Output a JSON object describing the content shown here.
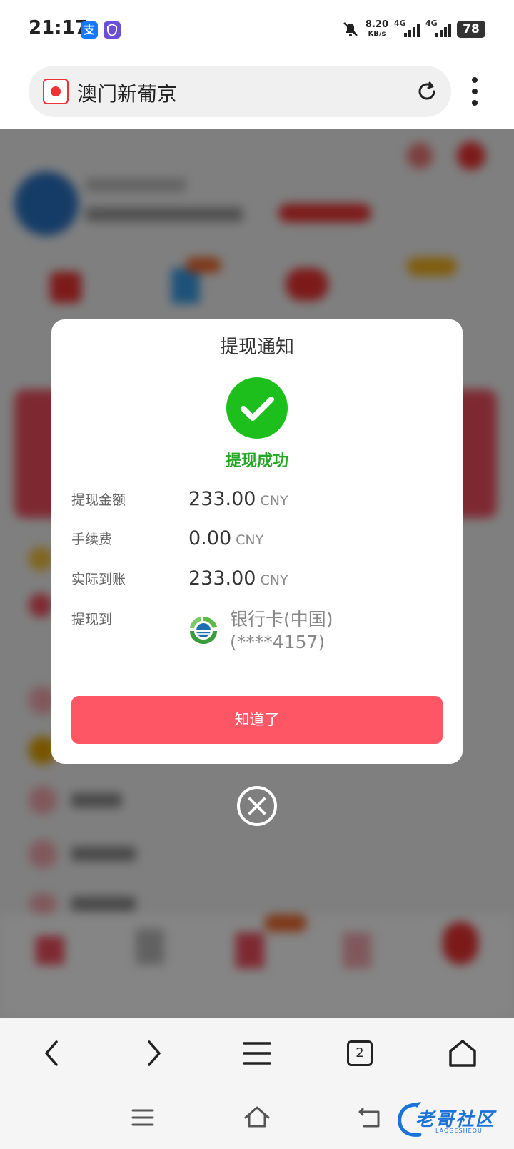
{
  "status_bar": {
    "time": "21:17",
    "alipay_badge": "支",
    "net_speed_value": "8.20",
    "net_speed_unit": "KB/s",
    "signal1_label": "4G",
    "signal2_label": "4G",
    "battery": "78"
  },
  "browser": {
    "page_title": "澳门新葡京"
  },
  "dialog": {
    "title": "提现通知",
    "status_text": "提现成功",
    "rows": [
      {
        "label": "提现金额",
        "value": "233.00",
        "unit": "CNY"
      },
      {
        "label": "手续费",
        "value": "0.00",
        "unit": "CNY"
      },
      {
        "label": "实际到账",
        "value": "233.00",
        "unit": "CNY"
      }
    ],
    "destination_label": "提现到",
    "bank_line1": "银行卡(中国)",
    "bank_line2": "(****4157)",
    "confirm_label": "知道了",
    "success_color": "#1dbf1d",
    "button_color": "#ff5665"
  },
  "toolbar": {
    "tab_count": "2",
    "icons": [
      "back-icon",
      "forward-icon",
      "menu-icon",
      "tabs-icon",
      "home-icon"
    ]
  },
  "watermark": {
    "text": "老哥社区",
    "sub": "LAOGESHEQU"
  }
}
